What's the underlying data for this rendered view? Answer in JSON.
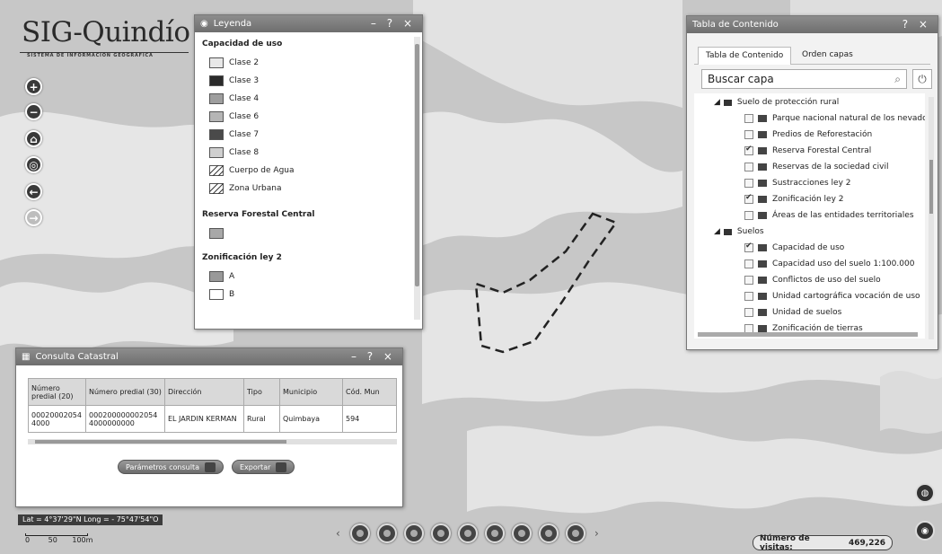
{
  "app": {
    "logo_text": "SIG-Quindío",
    "logo_subtitle": "SISTEMA DE INFORMACIÓN GEOGRÁFICA"
  },
  "colors": {
    "titlebar": "#7d7d7d",
    "map_light": "#e3e3e3",
    "map_dark": "#c4c4c4"
  },
  "map_tools": [
    {
      "icon": "zoom-in-icon",
      "glyph": "+"
    },
    {
      "icon": "zoom-out-icon",
      "glyph": "−"
    },
    {
      "icon": "home-icon",
      "glyph": "⌂"
    },
    {
      "icon": "locate-icon",
      "glyph": "◎"
    },
    {
      "icon": "back-icon",
      "glyph": "←"
    },
    {
      "icon": "forward-icon",
      "glyph": "→"
    }
  ],
  "legend": {
    "title": "Leyenda",
    "controls": "– ?",
    "close": "×",
    "sections": {
      "capacidad": "Capacidad de uso",
      "reserva": "Reserva Forestal Central",
      "zonificacion": "Zonificación ley 2"
    },
    "capacidad_items": [
      "Clase 2",
      "Clase 3",
      "Clase 4",
      "Clase 6",
      "Clase 7",
      "Clase 8",
      "Cuerpo de Agua",
      "Zona Urbana"
    ],
    "zonificacion_items": [
      "A",
      "B"
    ]
  },
  "toc": {
    "title": "Tabla de Contenido",
    "controls": "? ×",
    "tabs": [
      "Tabla de Contenido",
      "Orden capas"
    ],
    "search_placeholder": "Buscar capa",
    "groups": [
      {
        "label": "Suelo de protección rural",
        "layers": [
          {
            "label": "Parque nacional natural de los nevados",
            "checked": false
          },
          {
            "label": "Predios de Reforestación",
            "checked": false
          },
          {
            "label": "Reserva Forestal Central",
            "checked": true
          },
          {
            "label": "Reservas de la sociedad civil",
            "checked": false
          },
          {
            "label": "Sustracciones ley 2",
            "checked": false
          },
          {
            "label": "Zonificación ley 2",
            "checked": true
          },
          {
            "label": "Áreas de las entidades territoriales",
            "checked": false
          }
        ]
      },
      {
        "label": "Suelos",
        "layers": [
          {
            "label": "Capacidad de uso",
            "checked": true
          },
          {
            "label": "Capacidad uso del suelo 1:100.000",
            "checked": false
          },
          {
            "label": "Conflictos de uso del suelo",
            "checked": false
          },
          {
            "label": "Unidad cartográfica vocación de uso",
            "checked": false
          },
          {
            "label": "Unidad de suelos",
            "checked": false
          },
          {
            "label": "Zonificación de tierras",
            "checked": false
          }
        ]
      }
    ]
  },
  "cadastral": {
    "title": "Consulta Catastral",
    "controls": "– ? ×",
    "headers": [
      "Número predial (20)",
      "Número predial (30)",
      "Dirección",
      "Tipo",
      "Municipio",
      "Cód. Mun"
    ],
    "row": [
      "000200020544000",
      "0002000000020544000000000",
      "EL JARDIN KERMAN",
      "Rural",
      "Quimbaya",
      "594"
    ],
    "btn_params": "Parámetros consulta",
    "btn_export": "Exportar"
  },
  "coords_text": "Lat = 4°37'29\"N Long = - 75°47'54\"O",
  "scale": {
    "zero": "0",
    "mid": "50",
    "end": "100m"
  },
  "bottom_tools": [
    "measure-icon",
    "print-icon",
    "draw-icon",
    "layers-icon",
    "basemap-icon",
    "identify-icon",
    "globe-icon",
    "share-icon",
    "table-icon"
  ],
  "visits": {
    "label": "Número de visitas:",
    "value": "469,226"
  }
}
